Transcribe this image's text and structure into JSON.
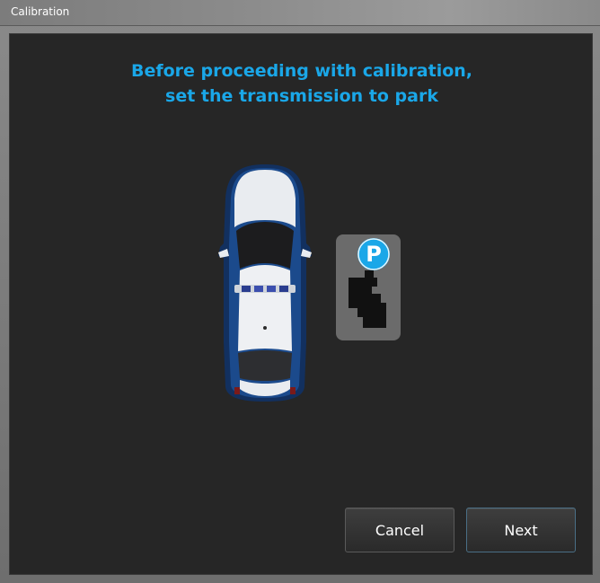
{
  "window": {
    "title": "Calibration"
  },
  "instruction": {
    "line1": "Before proceeding with calibration,",
    "line2": "set the transmission to park"
  },
  "illustration": {
    "vehicle_icon": "car-top-view-icon",
    "gear_icon": "park-gear-shifter-icon",
    "gear_label": "P",
    "accent_color": "#1aa7e8"
  },
  "buttons": {
    "cancel_label": "Cancel",
    "next_label": "Next"
  }
}
